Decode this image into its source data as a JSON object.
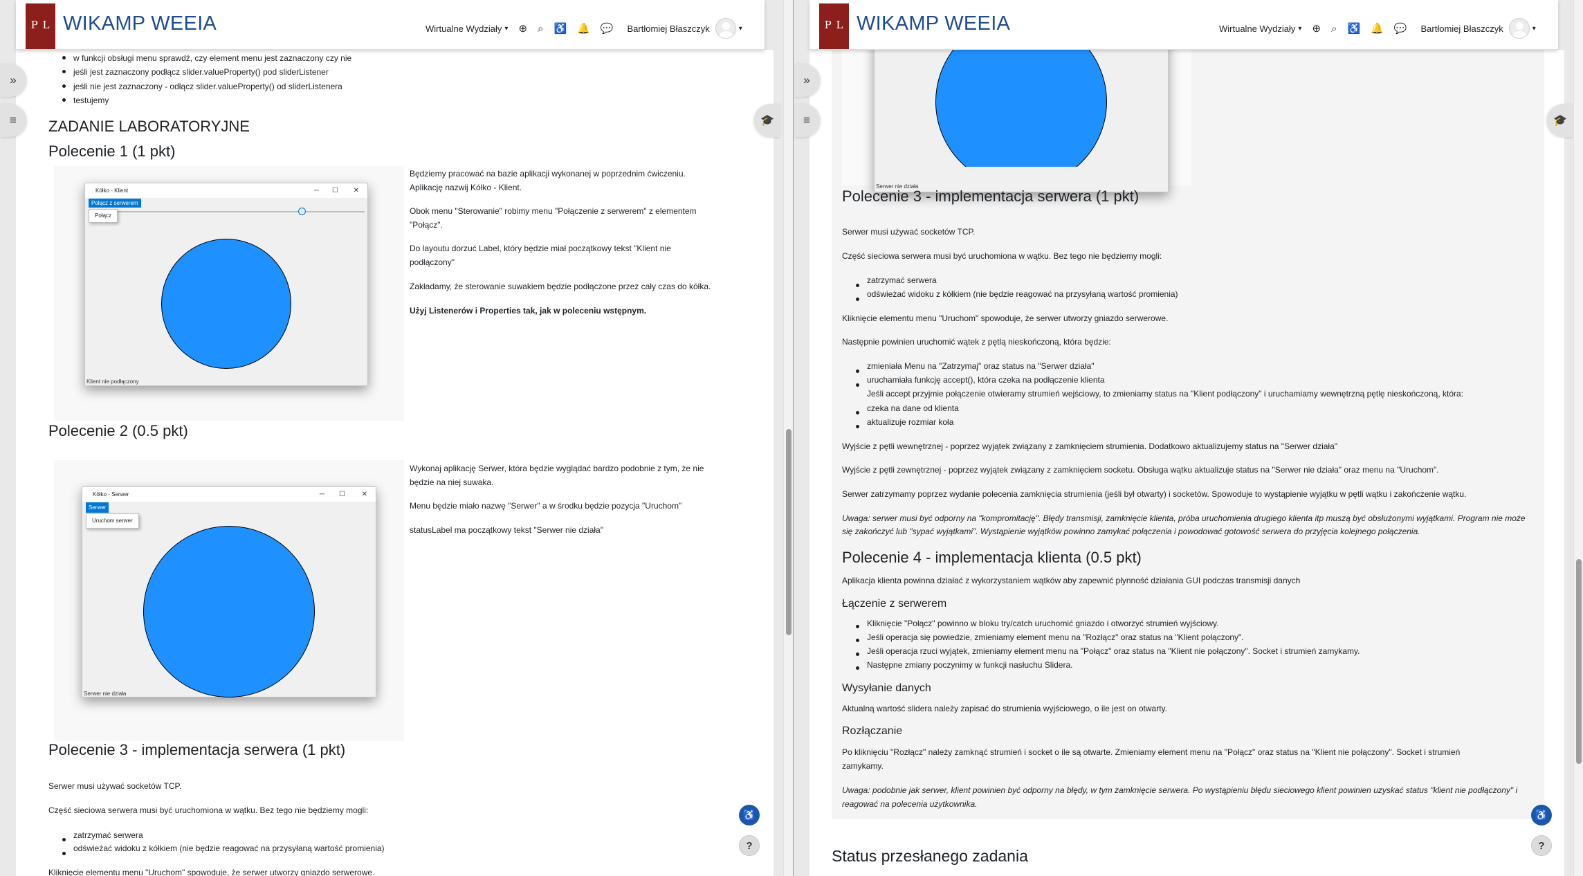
{
  "site": {
    "brand": "WIKAMP WEEIA",
    "logo_text": "P L",
    "nav_menu": "Wirtualne Wydziały",
    "user": "Bartłomiej Błaszczyk"
  },
  "left": {
    "top_list": [
      "w funkcji obsługi menu sprawdź, czy element menu jest zaznaczony czy nie",
      "jeśli jest zaznaczony podłącz slider.valueProperty() pod sliderListener",
      "jeśli nie jest zaznaczony - odłącz slider.valueProperty() od sliderListenera",
      "testujemy"
    ],
    "lab_heading": "ZADANIE LABORATORYJNE",
    "p1_heading": "Polecenie 1 (1 pkt)",
    "p1_lines": [
      "Będziemy pracować na bazie aplikacji wykonanej w poprzednim ćwiczeniu.",
      "Aplikację nazwij Kółko - Klient.",
      "Obok menu \"Sterowanie\" robimy menu \"Połączenie z serwerem\" z elementem",
      "\"Połącz\".",
      "Do layoutu dorzuć Label, który będzie miał początkowy tekst \"Klient nie",
      "podłączony\"",
      "Zakładamy, że sterowanie suwakiem będzie podłączone przez cały czas do kółka.",
      "Użyj Listenerów i Properties tak, jak w poleceniu wstępnym."
    ],
    "client_window": {
      "title": "Kółko - Klient",
      "menu": "Połącz z serwerem",
      "menu_item": "Połącz",
      "status": "Klient nie podłączony",
      "slider_value": 0.8
    },
    "p2_heading": "Polecenie 2 (0.5 pkt)",
    "p2_lines": [
      "Wykonaj aplikację Serwer, która będzie wyglądać bardzo podobnie z tym, że nie",
      "będzie na niej suwaka.",
      "Menu będzie miało nazwę \"Serwer\" a w środku będzie pozycja \"Uruchom\"",
      "statusLabel ma początkowy tekst \"Serwer nie działa\""
    ],
    "server_window": {
      "title": "Kółko - Serwer",
      "menu": "Serwer",
      "menu_item": "Uruchom serwer",
      "status": "Serwer nie działa"
    },
    "p3_heading": "Polecenie 3 - implementacja serwera (1 pkt)",
    "p3_lines": [
      "Serwer musi używać socketów TCP.",
      "Część sieciowa serwera musi być uruchomiona w wątku. Bez tego nie będziemy mogli:"
    ],
    "p3_list": [
      "zatrzymać serwera",
      "odświeżać widoku z kółkiem (nie będzie reagować na przysyłaną wartość promienia)"
    ],
    "p3_last": "Kliknięcie elementu menu \"Uruchom\" spowoduje, że serwer utworzy gniazdo serwerowe."
  },
  "right": {
    "server_status": "Serwer nie działa",
    "p3_heading": "Polecenie 3 - implementacja serwera (1 pkt)",
    "p3_intro": [
      "Serwer musi używać socketów TCP.",
      "Część sieciowa serwera musi być uruchomiona w wątku. Bez tego nie będziemy mogli:"
    ],
    "p3_list1": [
      "zatrzymać serwera",
      "odświeżać widoku z kółkiem (nie będzie reagować na przysyłaną wartość promienia)"
    ],
    "p3_click": "Kliknięcie elementu menu \"Uruchom\" spowoduje, że serwer utworzy gniazdo serwerowe.",
    "p3_next": "Następnie powinien uruchomić wątek z pętlą nieskończoną, która będzie:",
    "p3_list2": [
      "zmieniała Menu na \"Zatrzymaj\" oraz status na \"Serwer działa\"",
      "uruchamiała funkcję accept(), która czeka na podłączenie klienta",
      "Jeśli accept przyjmie połączenie otwieramy strumień wejściowy, to zmieniamy status na \"Klient podłączony\" i uruchamiamy wewnętrzną pętlę nieskończoną, która:",
      "czeka na dane od klienta",
      "aktualizuje rozmiar koła"
    ],
    "p3_exit1": "Wyjście z pętli wewnętrznej - poprzez wyjątek związany z zamknięciem strumienia. Dodatkowo aktualizujemy status na \"Serwer działa\"",
    "p3_exit2": "Wyjście z pętli zewnętrznej - poprzez wyjątek związany z zamknięciem socketu. Obsługa wątku aktualizuje status na \"Serwer nie działa\" oraz menu na \"Uruchom\".",
    "p3_stop": "Serwer zatrzymamy poprzez wydanie polecenia zamknięcia strumienia (jeśli był otwarty) i socketów. Spowoduje to wystąpienie wyjątku w pętli wątku i zakończenie wątku.",
    "p3_note1": "Uwaga: serwer musi być odporny na \"kompromitację\". Błędy transmisji, zamknięcie klienta, próba uruchomienia drugiego klienta itp muszą być obsłużonymi wyjątkami. Program nie może",
    "p3_note2": "się zakończyć lub \"sypać wyjątkami\". Wystąpienie wyjątków powinno zamykać połączenia i powodować gotowość serwera do przyjęcia kolejnego połączenia.",
    "p4_heading": "Polecenie 4 - implementacja klienta (0.5 pkt)",
    "p4_intro": "Aplikacja klienta powinna działać z wykorzystaniem wątków aby zapewnić płynność działania GUI podczas transmisji danych",
    "conn_heading": "Łączenie z serwerem",
    "conn_list": [
      "Kliknięcie \"Połącz\" powinno w bloku try/catch uruchomić gniazdo i otworzyć strumień wyjściowy.",
      "Jeśli operacja się powiedzie, zmieniamy element menu na \"Rozłącz\" oraz status na \"Klient połączony\".",
      "Jeśli operacja rzuci wyjątek, zmieniamy element menu na \"Połącz\" oraz status na \"Klient nie połączony\". Socket i strumień zamykamy.",
      "Następne zmiany poczynimy w funkcji nasłuchu Slidera."
    ],
    "send_heading": "Wysyłanie danych",
    "send_text": "Aktualną wartość slidera należy zapisać do strumienia wyjściowego, o ile jest on otwarty.",
    "disc_heading": "Rozłączanie",
    "disc_text1": "Po kliknięciu \"Rozłącz\" należy zamknąć strumień i socket o ile są otwarte. Zmieniamy element menu na \"Połącz\" oraz status na \"Klient nie połączony\". Socket i strumień",
    "disc_text2": "zamykamy.",
    "disc_note1": "Uwaga: podobnie jak serwer, klient powinien być odporny na błędy, w tym zamknięcie serwera. Po wystąpieniu błędu sieciowego klient powinien uzyskać status \"klient nie podłączony\" i",
    "disc_note2": "reagować na polecenia użytkownika.",
    "status_heading": "Status przesłanego zadania"
  }
}
